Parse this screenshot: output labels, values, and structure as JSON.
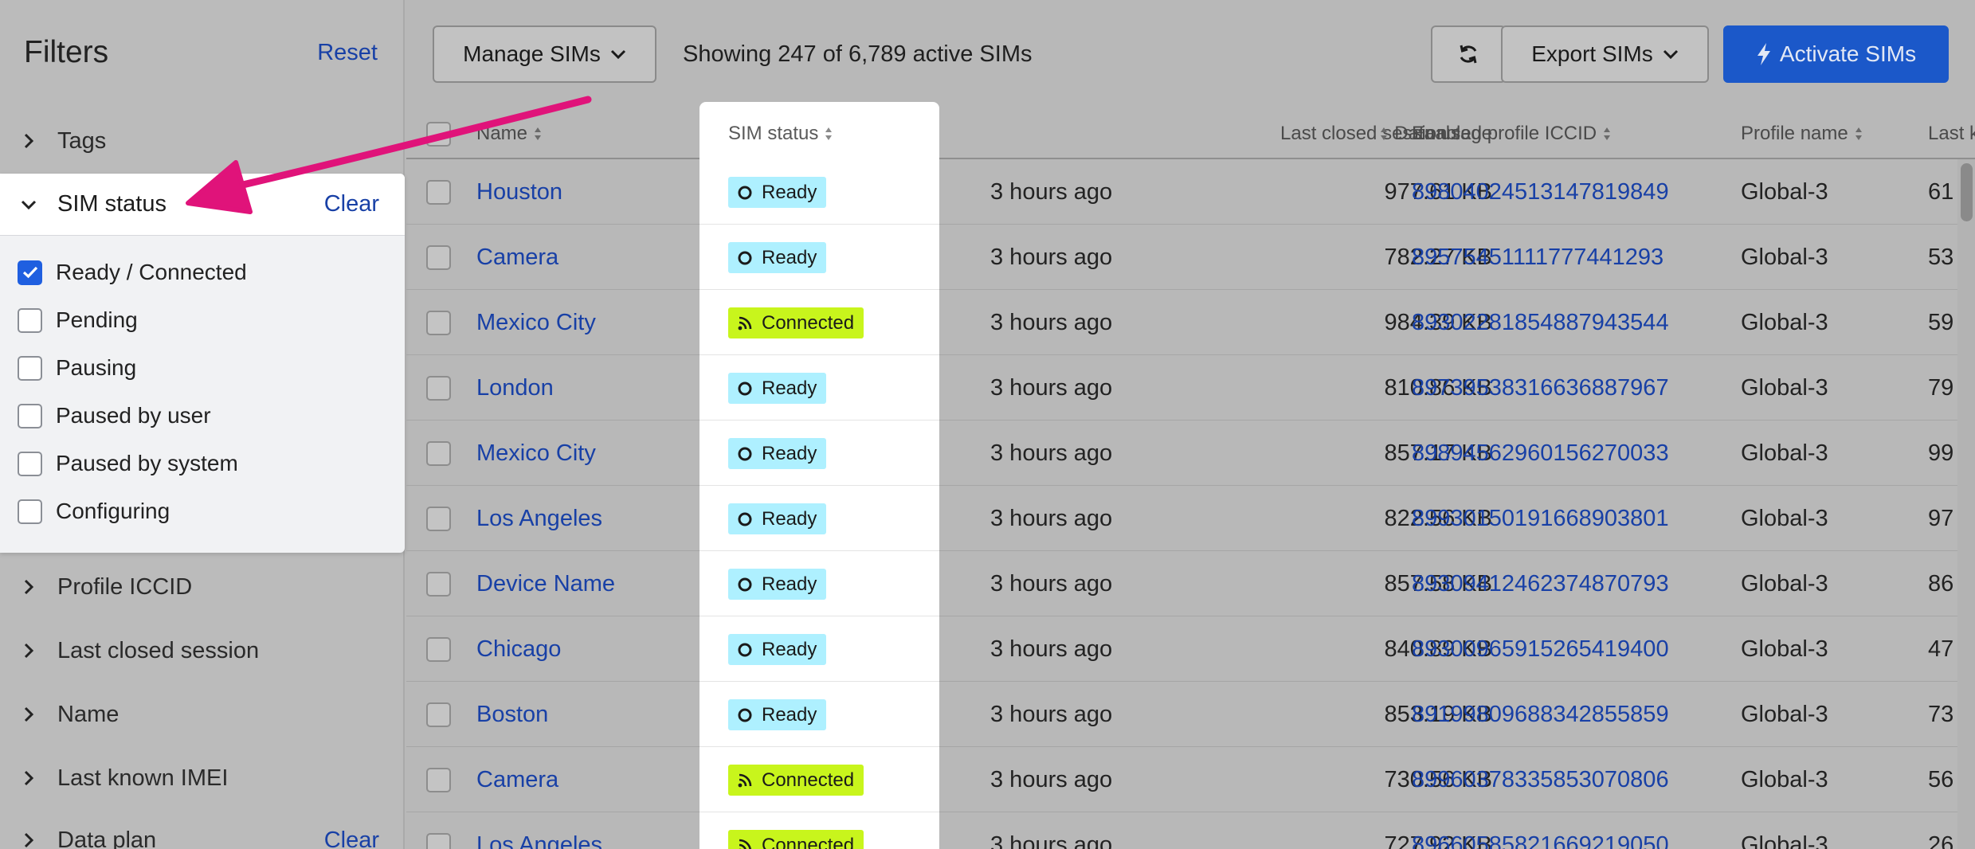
{
  "sidebar": {
    "title": "Filters",
    "reset_label": "Reset",
    "groups": [
      {
        "label": "Tags"
      },
      {
        "label": "Profile ICCID"
      },
      {
        "label": "Last closed session"
      },
      {
        "label": "Name"
      },
      {
        "label": "Last known IMEI"
      },
      {
        "label": "Data plan",
        "clear_label": "Clear"
      }
    ],
    "sim_status": {
      "label": "SIM status",
      "clear_label": "Clear",
      "options": [
        {
          "label": "Ready / Connected",
          "checked": true
        },
        {
          "label": "Pending",
          "checked": false
        },
        {
          "label": "Pausing",
          "checked": false
        },
        {
          "label": "Paused by user",
          "checked": false
        },
        {
          "label": "Paused by system",
          "checked": false
        },
        {
          "label": "Configuring",
          "checked": false
        }
      ]
    }
  },
  "toolbar": {
    "manage_label": "Manage SIMs",
    "showing_text": "Showing 247 of 6,789 active SIMs",
    "export_label": "Export SIMs",
    "activate_label": "Activate SIMs"
  },
  "table": {
    "headers": {
      "name": "Name",
      "status": "SIM status",
      "last_session": "Last closed session",
      "data_usage": "Data usage",
      "iccid": "Enabled profile ICCID",
      "profile": "Profile name",
      "last_known": "Last k"
    },
    "rows": [
      {
        "name": "Houston",
        "status": "Ready",
        "last": "3 hours ago",
        "data": "977.61 KB",
        "iccid": "89804024513147819849",
        "profile": "Global-3",
        "lastk": "61"
      },
      {
        "name": "Camera",
        "status": "Ready",
        "last": "3 hours ago",
        "data": "782.27 KB",
        "iccid": "89575451111777441293",
        "profile": "Global-3",
        "lastk": "53"
      },
      {
        "name": "Mexico City",
        "status": "Connected",
        "last": "3 hours ago",
        "data": "984.39 KB",
        "iccid": "89302281854887943544",
        "profile": "Global-3",
        "lastk": "59"
      },
      {
        "name": "London",
        "status": "Ready",
        "last": "3 hours ago",
        "data": "810.86 KB",
        "iccid": "89739538316636887967",
        "profile": "Global-3",
        "lastk": "79"
      },
      {
        "name": "Mexico City",
        "status": "Ready",
        "last": "3 hours ago",
        "data": "857.17 KB",
        "iccid": "89894562960156270033",
        "profile": "Global-3",
        "lastk": "99"
      },
      {
        "name": "Los Angeles",
        "status": "Ready",
        "last": "3 hours ago",
        "data": "822.56 KB",
        "iccid": "89930150191668903801",
        "profile": "Global-3",
        "lastk": "97"
      },
      {
        "name": "Device Name",
        "status": "Ready",
        "last": "3 hours ago",
        "data": "857.58 KB",
        "iccid": "89309412462374870793",
        "profile": "Global-3",
        "lastk": "86"
      },
      {
        "name": "Chicago",
        "status": "Ready",
        "last": "3 hours ago",
        "data": "840.89 KB",
        "iccid": "89300965915265419400",
        "profile": "Global-3",
        "lastk": "47"
      },
      {
        "name": "Boston",
        "status": "Ready",
        "last": "3 hours ago",
        "data": "853.19 KB",
        "iccid": "89199809688342855859",
        "profile": "Global-3",
        "lastk": "73"
      },
      {
        "name": "Camera",
        "status": "Connected",
        "last": "3 hours ago",
        "data": "730.56 KB",
        "iccid": "89960378335853070806",
        "profile": "Global-3",
        "lastk": "56"
      },
      {
        "name": "Los Angeles",
        "status": "Connected",
        "last": "3 hours ago",
        "data": "727.92 KB",
        "iccid": "89660585821669219050",
        "profile": "Global-3",
        "lastk": "26"
      }
    ]
  },
  "colors": {
    "accent": "#1b58c9",
    "link": "#1840a6",
    "ready_badge": "#aef0ff",
    "connected_badge": "#c8f51c",
    "annotation_arrow": "#e0137a"
  }
}
